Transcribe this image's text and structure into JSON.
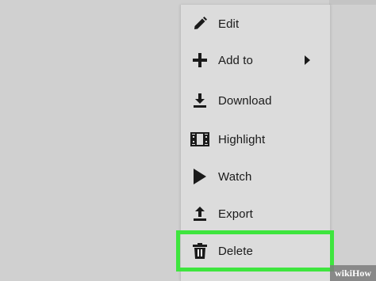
{
  "menu": {
    "items": [
      {
        "label": "Edit",
        "icon": "pencil-icon"
      },
      {
        "label": "Add to",
        "icon": "plus-icon",
        "has_submenu": true
      },
      {
        "label": "Download",
        "icon": "download-icon"
      },
      {
        "label": "Highlight",
        "icon": "film-icon"
      },
      {
        "label": "Watch",
        "icon": "play-icon"
      },
      {
        "label": "Export",
        "icon": "upload-icon"
      },
      {
        "label": "Delete",
        "icon": "trash-icon",
        "highlighted": true
      }
    ]
  },
  "watermark": {
    "text": "wikiHow"
  },
  "colors": {
    "background": "#d0d0d0",
    "menu": "#dcdcdc",
    "highlight_border": "#3ee53e",
    "selected_row": "#ffffff",
    "text": "#1a1a1a"
  }
}
